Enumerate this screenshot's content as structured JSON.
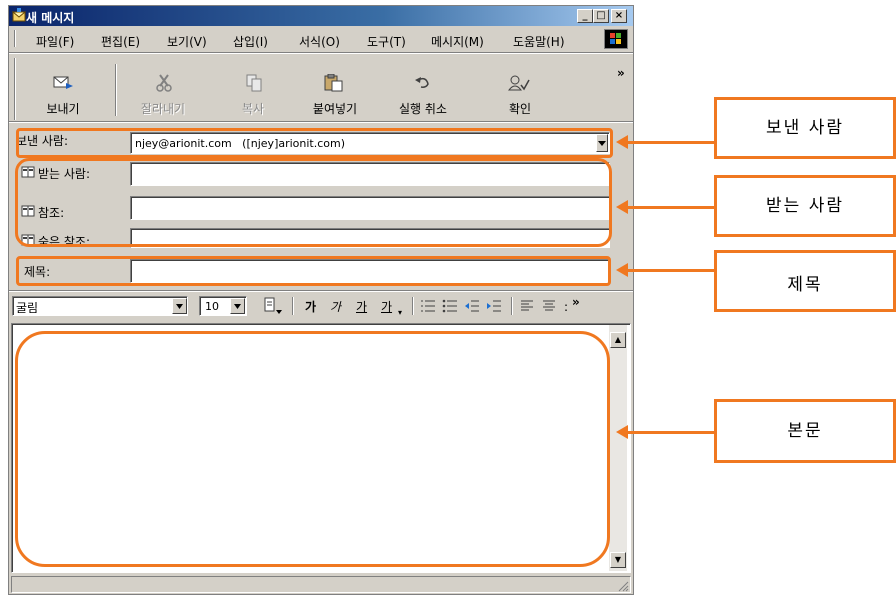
{
  "window": {
    "title": "새 메시지",
    "min_glyph": "_",
    "max_glyph": "□",
    "close_glyph": "×"
  },
  "menu": [
    "파일(F)",
    "편집(E)",
    "보기(V)",
    "삽입(I)",
    "서식(O)",
    "도구(T)",
    "메시지(M)",
    "도움말(H)"
  ],
  "toolbar": {
    "send": "보내기",
    "cut": "잘라내기",
    "copy": "복사",
    "paste": "붙여넣기",
    "undo": "실행 취소",
    "check": "확인",
    "overflow": "»"
  },
  "fields": {
    "from_label": "보낸 사람:",
    "from_value": "njey@arionit.com   ([njey]arionit.com)",
    "to_label": "받는 사람:",
    "to_value": "",
    "cc_label": "참조:",
    "cc_value": "",
    "bcc_label": "숨은 참조:",
    "bcc_value": "",
    "subject_label": "제목:",
    "subject_value": ""
  },
  "format": {
    "font": "굴림",
    "size": "10",
    "bold": "가",
    "italic": "가",
    "underline": "가",
    "font_color": "가",
    "overflow": "»"
  },
  "callouts": {
    "from": "보낸 사람",
    "to": "받는 사람",
    "subject": "제목",
    "body": "본문"
  },
  "colors": {
    "accent": "#f07820",
    "titlebar": "#0a246a",
    "chrome": "#d4d0c8"
  }
}
